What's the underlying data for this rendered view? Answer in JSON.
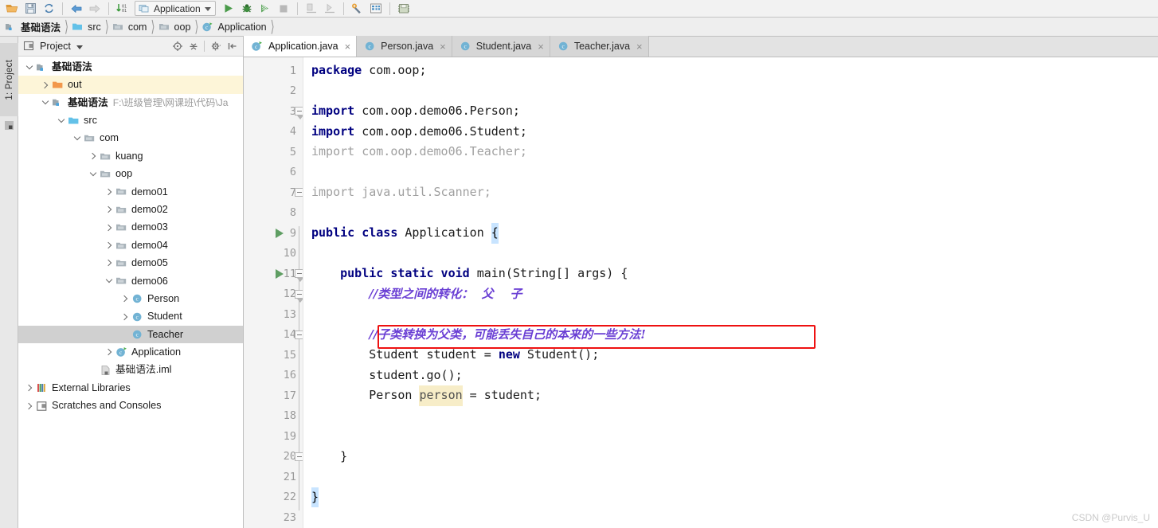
{
  "toolbar": {
    "icons": [
      {
        "name": "open-folder-icon",
        "glyph": "folder-open"
      },
      {
        "name": "save-all-icon",
        "glyph": "save"
      },
      {
        "name": "sync-icon",
        "glyph": "sync"
      },
      {
        "name": "back-icon",
        "glyph": "arrow-left"
      },
      {
        "name": "forward-icon",
        "glyph": "arrow-right"
      },
      {
        "name": "compile-icon",
        "glyph": "compile"
      },
      {
        "name": "run-icon",
        "glyph": "play"
      },
      {
        "name": "debug-icon",
        "glyph": "bug"
      },
      {
        "name": "run-coverage-icon",
        "glyph": "coverage"
      },
      {
        "name": "stop-icon",
        "glyph": "stop"
      },
      {
        "name": "update-app-icon",
        "glyph": "update-app"
      },
      {
        "name": "rerun-icon",
        "glyph": "rerun"
      },
      {
        "name": "settings-icon",
        "glyph": "wrench"
      },
      {
        "name": "project-structure-icon",
        "glyph": "structure"
      },
      {
        "name": "sdk-icon",
        "glyph": "sdk"
      }
    ],
    "run_config": "Application"
  },
  "breadcrumb": {
    "items": [
      {
        "label": "基础语法",
        "icon": "module-icon",
        "bold": true
      },
      {
        "label": "src",
        "icon": "source-folder-icon",
        "bold": false
      },
      {
        "label": "com",
        "icon": "package-icon",
        "bold": false
      },
      {
        "label": "oop",
        "icon": "package-icon",
        "bold": false
      },
      {
        "label": "Application",
        "icon": "java-class-icon",
        "bold": false
      }
    ]
  },
  "tool_window": {
    "vertical_tab": "1: Project"
  },
  "project_panel": {
    "title": "Project",
    "header_icons": [
      {
        "name": "locate-icon"
      },
      {
        "name": "collapse-all-icon"
      },
      {
        "name": "settings-gear-icon"
      },
      {
        "name": "hide-panel-icon"
      }
    ],
    "tree": [
      {
        "label": "基础语法",
        "indent": 0,
        "arrow": "down",
        "icon": "project-icon",
        "bold": true,
        "state": "normal"
      },
      {
        "label": "out",
        "indent": 1,
        "arrow": "right",
        "icon": "out-folder-icon",
        "bold": false,
        "state": "highlight"
      },
      {
        "label": "基础语法",
        "indent": 1,
        "arrow": "down",
        "icon": "module-icon",
        "bold": true,
        "state": "normal",
        "path": "F:\\班级管理\\网课班\\代码\\Ja"
      },
      {
        "label": "src",
        "indent": 2,
        "arrow": "down",
        "icon": "source-folder-icon",
        "bold": false,
        "state": "normal"
      },
      {
        "label": "com",
        "indent": 3,
        "arrow": "down",
        "icon": "package-icon",
        "bold": false,
        "state": "normal"
      },
      {
        "label": "kuang",
        "indent": 4,
        "arrow": "right",
        "icon": "package-icon",
        "bold": false,
        "state": "normal"
      },
      {
        "label": "oop",
        "indent": 4,
        "arrow": "down",
        "icon": "package-icon",
        "bold": false,
        "state": "normal"
      },
      {
        "label": "demo01",
        "indent": 5,
        "arrow": "right",
        "icon": "package-icon",
        "bold": false,
        "state": "normal"
      },
      {
        "label": "demo02",
        "indent": 5,
        "arrow": "right",
        "icon": "package-icon",
        "bold": false,
        "state": "normal"
      },
      {
        "label": "demo03",
        "indent": 5,
        "arrow": "right",
        "icon": "package-icon",
        "bold": false,
        "state": "normal"
      },
      {
        "label": "demo04",
        "indent": 5,
        "arrow": "right",
        "icon": "package-icon",
        "bold": false,
        "state": "normal"
      },
      {
        "label": "demo05",
        "indent": 5,
        "arrow": "right",
        "icon": "package-icon",
        "bold": false,
        "state": "normal"
      },
      {
        "label": "demo06",
        "indent": 5,
        "arrow": "down",
        "icon": "package-icon",
        "bold": false,
        "state": "normal"
      },
      {
        "label": "Person",
        "indent": 6,
        "arrow": "right",
        "icon": "java-class-icon",
        "bold": false,
        "state": "normal"
      },
      {
        "label": "Student",
        "indent": 6,
        "arrow": "right",
        "icon": "java-class-icon",
        "bold": false,
        "state": "normal"
      },
      {
        "label": "Teacher",
        "indent": 6,
        "arrow": "none",
        "icon": "java-class-icon",
        "bold": false,
        "state": "selected"
      },
      {
        "label": "Application",
        "indent": 5,
        "arrow": "right",
        "icon": "java-runnable-class-icon",
        "bold": false,
        "state": "normal"
      },
      {
        "label": "基础语法.iml",
        "indent": 4,
        "arrow": "none",
        "icon": "iml-file-icon",
        "bold": false,
        "state": "normal"
      },
      {
        "label": "External Libraries",
        "indent": 0,
        "arrow": "right",
        "icon": "libraries-icon",
        "bold": false,
        "state": "normal"
      },
      {
        "label": "Scratches and Consoles",
        "indent": 0,
        "arrow": "right",
        "icon": "scratches-icon",
        "bold": false,
        "state": "normal"
      }
    ]
  },
  "editor": {
    "tabs": [
      {
        "label": "Application.java",
        "icon": "java-runnable-class-icon",
        "active": true,
        "close": "×"
      },
      {
        "label": "Person.java",
        "icon": "java-class-icon",
        "active": false,
        "close": "×"
      },
      {
        "label": "Student.java",
        "icon": "java-class-icon",
        "active": false,
        "close": "×"
      },
      {
        "label": "Teacher.java",
        "icon": "java-class-icon",
        "active": false,
        "close": "×"
      }
    ],
    "line_numbers": [
      "1",
      "2",
      "3",
      "4",
      "5",
      "6",
      "7",
      "8",
      "9",
      "10",
      "11",
      "12",
      "13",
      "14",
      "15",
      "16",
      "17",
      "18",
      "19",
      "20",
      "21",
      "22",
      "23"
    ],
    "run_gutter_lines": [
      9,
      11
    ],
    "code": [
      {
        "n": 1,
        "tokens": [
          {
            "t": "package",
            "c": "kw"
          },
          {
            "t": " com.oop;",
            "c": "plain"
          }
        ]
      },
      {
        "n": 2,
        "tokens": []
      },
      {
        "n": 3,
        "tokens": [
          {
            "t": "import",
            "c": "kw"
          },
          {
            "t": " com.oop.demo06.Person;",
            "c": "plain"
          }
        ]
      },
      {
        "n": 4,
        "tokens": [
          {
            "t": "import",
            "c": "kw"
          },
          {
            "t": " com.oop.demo06.Student;",
            "c": "plain"
          }
        ]
      },
      {
        "n": 5,
        "tokens": [
          {
            "t": "import com.oop.demo06.Teacher;",
            "c": "dim"
          }
        ]
      },
      {
        "n": 6,
        "tokens": []
      },
      {
        "n": 7,
        "tokens": [
          {
            "t": "import java.util.Scanner;",
            "c": "dim"
          }
        ]
      },
      {
        "n": 8,
        "tokens": []
      },
      {
        "n": 9,
        "tokens": [
          {
            "t": "public class",
            "c": "kw"
          },
          {
            "t": " Application ",
            "c": "plain"
          },
          {
            "t": "{",
            "c": "brhl"
          }
        ]
      },
      {
        "n": 10,
        "tokens": []
      },
      {
        "n": 11,
        "tokens": [
          {
            "t": "    ",
            "c": "plain"
          },
          {
            "t": "public static void",
            "c": "kw"
          },
          {
            "t": " main(String[] args) {",
            "c": "plain"
          }
        ]
      },
      {
        "n": 12,
        "tokens": [
          {
            "t": "        ",
            "c": "plain"
          },
          {
            "t": "//类型之间的转化：  父    子",
            "c": "cmt"
          }
        ]
      },
      {
        "n": 13,
        "tokens": []
      },
      {
        "n": 14,
        "tokens": [
          {
            "t": "        ",
            "c": "plain"
          },
          {
            "t": "//子类转换为父类，可能丢失自己的本来的一些方法!",
            "c": "cmt"
          }
        ]
      },
      {
        "n": 15,
        "tokens": [
          {
            "t": "        Student student = ",
            "c": "plain"
          },
          {
            "t": "new",
            "c": "kw"
          },
          {
            "t": " Student();",
            "c": "plain"
          }
        ]
      },
      {
        "n": 16,
        "tokens": [
          {
            "t": "        student.go();",
            "c": "plain"
          }
        ]
      },
      {
        "n": 17,
        "tokens": [
          {
            "t": "        Person ",
            "c": "plain"
          },
          {
            "t": "person",
            "c": "varhl"
          },
          {
            "t": " = student;",
            "c": "plain"
          }
        ]
      },
      {
        "n": 18,
        "tokens": []
      },
      {
        "n": 19,
        "tokens": []
      },
      {
        "n": 20,
        "tokens": [
          {
            "t": "    }",
            "c": "plain"
          }
        ]
      },
      {
        "n": 21,
        "tokens": []
      },
      {
        "n": 22,
        "tokens": [
          {
            "t": "}",
            "c": "brhl"
          }
        ]
      },
      {
        "n": 23,
        "tokens": []
      }
    ],
    "annotation_box": {
      "target_line": 14,
      "color": "#ee1111"
    }
  },
  "watermark": "CSDN @Purvis_U"
}
